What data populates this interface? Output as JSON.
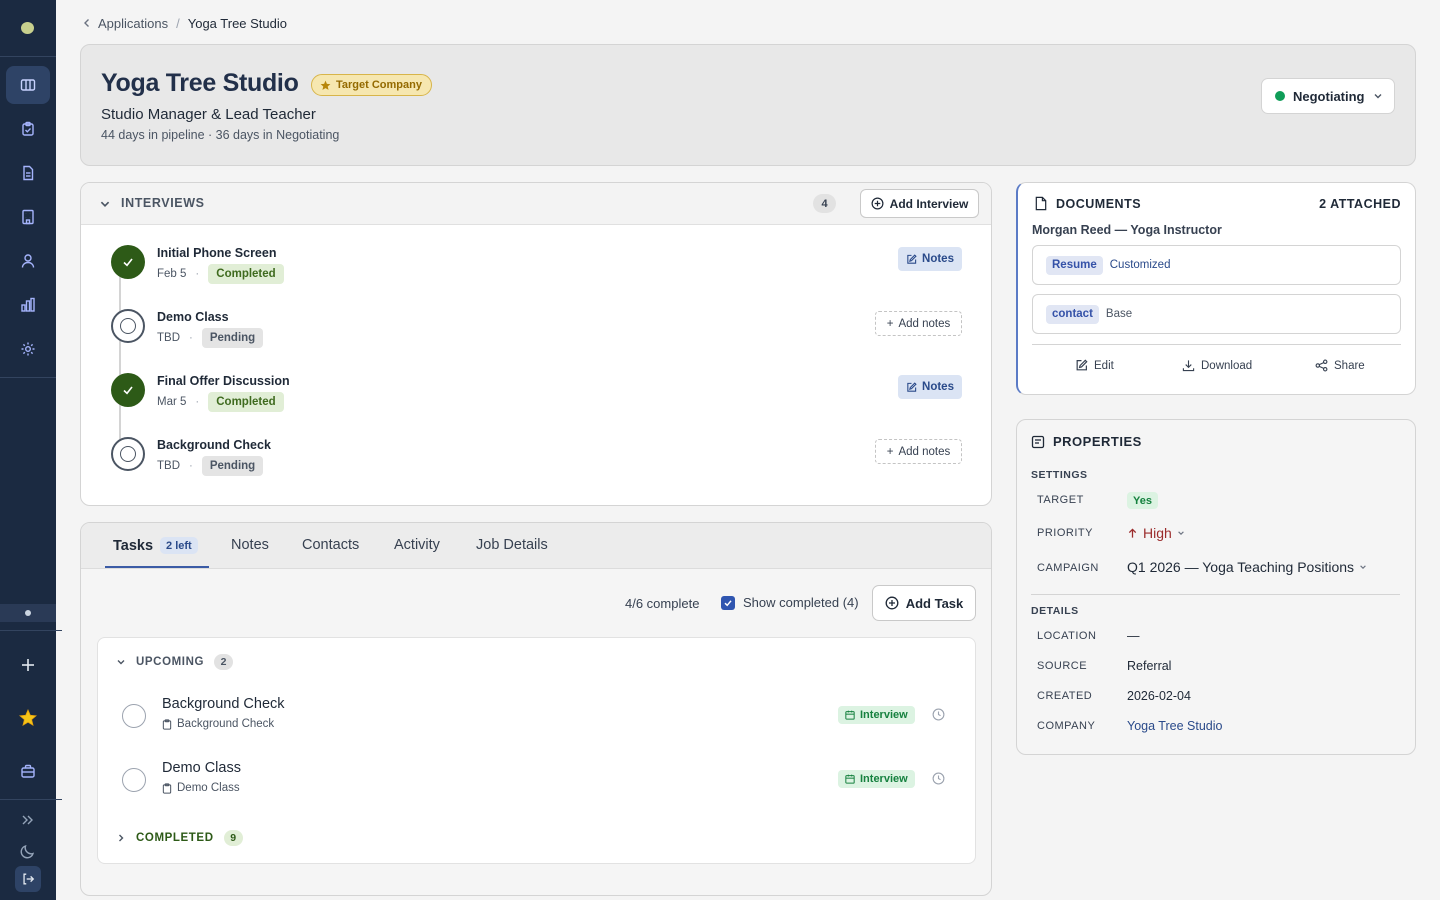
{
  "breadcrumb": {
    "parent": "Applications",
    "current": "Yoga Tree Studio"
  },
  "header": {
    "company": "Yoga Tree Studio",
    "target_badge": "Target Company",
    "job_title": "Studio Manager & Lead Teacher",
    "pipeline": "44 days in pipeline · 36 days in Negotiating",
    "status": "Negotiating",
    "status_color": "#0f9d58"
  },
  "interviews": {
    "title": "INTERVIEWS",
    "count": "4",
    "add_label": "Add Interview",
    "items": [
      {
        "name": "Initial Phone Screen",
        "date": "Feb 5",
        "status": "Completed",
        "notes": "Notes"
      },
      {
        "name": "Demo Class",
        "date": "TBD",
        "status": "Pending",
        "notes": "Add notes"
      },
      {
        "name": "Final Offer Discussion",
        "date": "Mar 5",
        "status": "Completed",
        "notes": "Notes"
      },
      {
        "name": "Background Check",
        "date": "TBD",
        "status": "Pending",
        "notes": "Add notes"
      }
    ]
  },
  "tabs": [
    {
      "label": "Tasks",
      "badge": "2 left"
    },
    {
      "label": "Notes"
    },
    {
      "label": "Contacts"
    },
    {
      "label": "Activity"
    },
    {
      "label": "Job Details"
    }
  ],
  "tasks": {
    "progress": "4/6 complete",
    "show_completed": "Show completed (4)",
    "add_label": "Add Task",
    "upcoming_label": "UPCOMING",
    "upcoming_count": "2",
    "completed_label": "COMPLETED",
    "completed_count": "9",
    "items": [
      {
        "name": "Background Check",
        "linked": "Background Check",
        "tag": "Interview"
      },
      {
        "name": "Demo Class",
        "linked": "Demo Class",
        "tag": "Interview"
      }
    ]
  },
  "documents": {
    "title": "DOCUMENTS",
    "attached": "2 ATTACHED",
    "owner": "Morgan Reed — Yoga Instructor",
    "items": [
      {
        "type": "Resume",
        "variant": "Customized",
        "variant_color": "#2a4a8a"
      },
      {
        "type": "contact",
        "variant": "Base",
        "variant_color": "#4b5563"
      }
    ],
    "actions": {
      "edit": "Edit",
      "download": "Download",
      "share": "Share"
    }
  },
  "properties": {
    "title": "PROPERTIES",
    "settings_label": "SETTINGS",
    "target_label": "TARGET",
    "target_value": "Yes",
    "priority_label": "PRIORITY",
    "priority_value": "High",
    "campaign_label": "CAMPAIGN",
    "campaign_value": "Q1 2026 — Yoga Teaching Positions",
    "details_label": "DETAILS",
    "location_label": "LOCATION",
    "location_value": "—",
    "source_label": "SOURCE",
    "source_value": "Referral",
    "created_label": "CREATED",
    "created_value": "2026-02-04",
    "company_label": "COMPANY",
    "company_value": "Yoga Tree Studio"
  },
  "colors": {
    "accent": "#3b5ba5",
    "sidebar": "#1b2a41",
    "priority": "#9b2c2c"
  }
}
